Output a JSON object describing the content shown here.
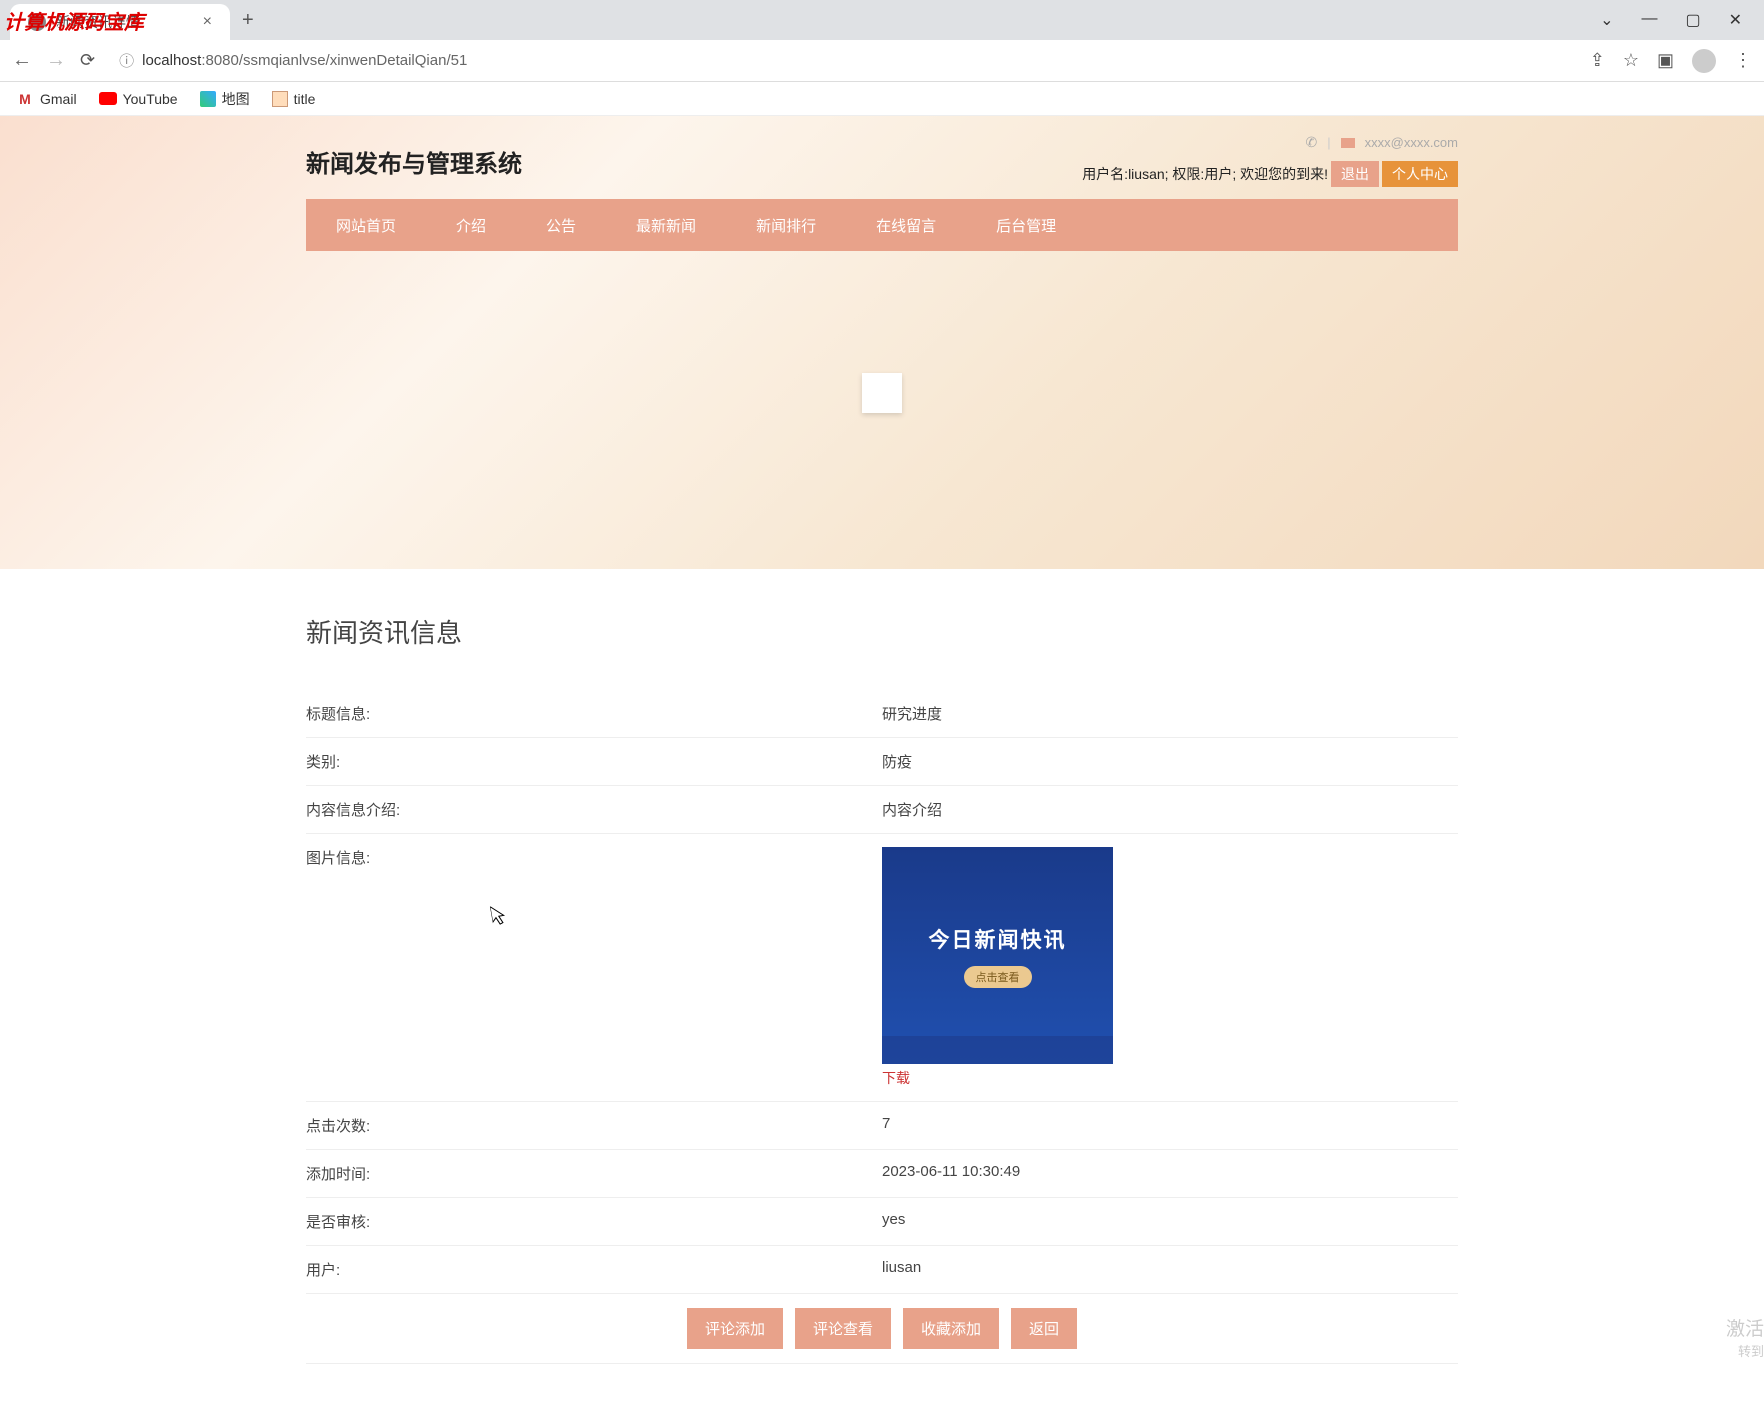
{
  "watermark": "计算机源码宝库",
  "browser": {
    "tab_title": "新闻资讯详情",
    "url_prefix": "localhost",
    "url_rest": ":8080/ssmqianlvse/xinwenDetailQian/51"
  },
  "bookmarks": {
    "gmail": "Gmail",
    "youtube": "YouTube",
    "maps": "地图",
    "title": "title"
  },
  "header": {
    "site_title": "新闻发布与管理系统",
    "email": "xxxx@xxxx.com",
    "user_info": "用户名:liusan; 权限:用户; 欢迎您的到来!",
    "logout": "退出",
    "profile": "个人中心"
  },
  "nav": {
    "home": "网站首页",
    "intro": "介绍",
    "notice": "公告",
    "latest": "最新新闻",
    "rank": "新闻排行",
    "message": "在线留言",
    "admin": "后台管理"
  },
  "page_heading": "新闻资讯信息",
  "details": {
    "title_label": "标题信息:",
    "title_value": "研究进度",
    "category_label": "类别:",
    "category_value": "防疫",
    "content_label": "内容信息介绍:",
    "content_value": "内容介绍",
    "image_label": "图片信息:",
    "image_caption": "今日新闻快讯",
    "image_btn": "点击查看",
    "download": "下载",
    "clicks_label": "点击次数:",
    "clicks_value": "7",
    "addtime_label": "添加时间:",
    "addtime_value": "2023-06-11 10:30:49",
    "audit_label": "是否审核:",
    "audit_value": "yes",
    "user_label": "用户:",
    "user_value": "liusan"
  },
  "actions": {
    "comment_add": "评论添加",
    "comment_view": "评论查看",
    "favorite_add": "收藏添加",
    "back": "返回"
  },
  "activation": {
    "line1": "激活",
    "line2": "转到"
  }
}
